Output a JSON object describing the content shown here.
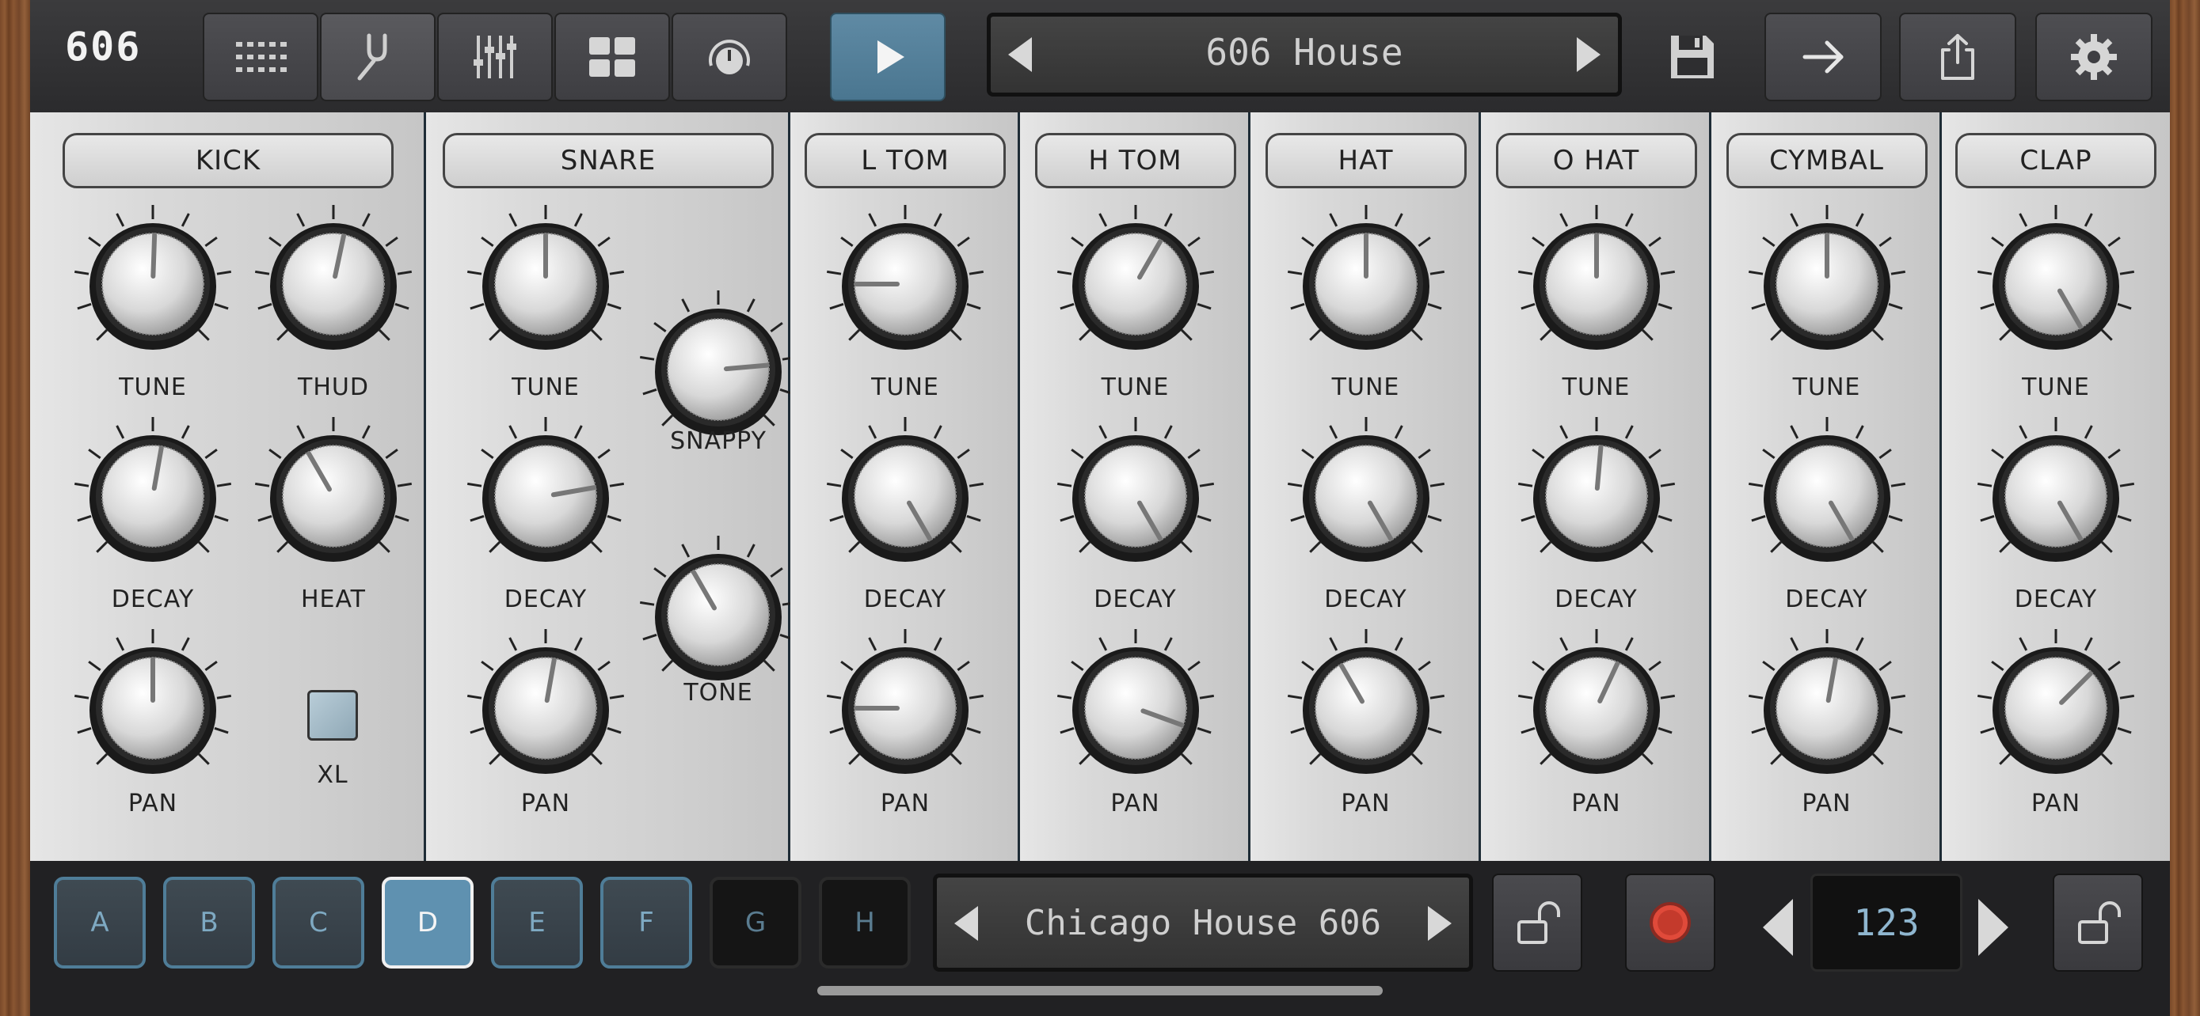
{
  "app": {
    "logo": "606"
  },
  "toolbar": {
    "tabs": [
      {
        "name": "pattern-grid-tab",
        "icon": "grid-dots-icon"
      },
      {
        "name": "tune-tab",
        "icon": "tuning-fork-icon"
      },
      {
        "name": "mixer-tab",
        "icon": "sliders-icon"
      },
      {
        "name": "pads-tab",
        "icon": "four-squares-icon"
      },
      {
        "name": "knob-tab",
        "icon": "knob-icon"
      }
    ],
    "play_icon": "play-icon",
    "save_icon": "floppy-disk-icon",
    "export_icon": "arrow-right-icon",
    "share_icon": "share-icon",
    "settings_icon": "gear-icon"
  },
  "preset": {
    "name": "606 House"
  },
  "instruments": [
    {
      "label": "KICK",
      "knobs": [
        "TUNE",
        "THUD",
        "DECAY",
        "HEAT",
        "PAN"
      ],
      "extra": "XL"
    },
    {
      "label": "SNARE",
      "knobs": [
        "TUNE",
        "SNAPPY",
        "DECAY",
        "TONE",
        "PAN"
      ]
    },
    {
      "label": "L TOM",
      "knobs": [
        "TUNE",
        "DECAY",
        "PAN"
      ]
    },
    {
      "label": "H TOM",
      "knobs": [
        "TUNE",
        "DECAY",
        "PAN"
      ]
    },
    {
      "label": "HAT",
      "knobs": [
        "TUNE",
        "DECAY",
        "PAN"
      ]
    },
    {
      "label": "O HAT",
      "knobs": [
        "TUNE",
        "DECAY",
        "PAN"
      ]
    },
    {
      "label": "CYMBAL",
      "knobs": [
        "TUNE",
        "DECAY",
        "PAN"
      ]
    },
    {
      "label": "CLAP",
      "knobs": [
        "TUNE",
        "DECAY",
        "PAN"
      ]
    }
  ],
  "patterns": {
    "labels": [
      "A",
      "B",
      "C",
      "D",
      "E",
      "F",
      "G",
      "H"
    ],
    "selected": "D"
  },
  "kit": {
    "name": "Chicago House 606"
  },
  "tempo": {
    "value": "123"
  },
  "bottom_icons": {
    "lock": "unlock-icon",
    "record": "record-icon"
  },
  "colors": {
    "accent": "#5f91b0",
    "play": "#4a7690",
    "record": "#e04a3a"
  }
}
